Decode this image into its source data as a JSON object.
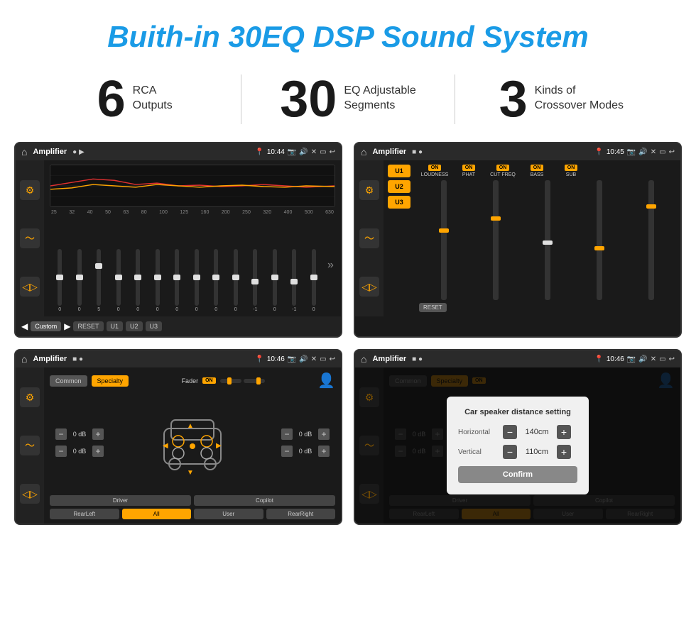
{
  "header": {
    "title": "Buith-in 30EQ DSP Sound System"
  },
  "stats": [
    {
      "number": "6",
      "label": "RCA\nOutputs"
    },
    {
      "number": "30",
      "label": "EQ Adjustable\nSegments"
    },
    {
      "number": "3",
      "label": "Kinds of\nCrossover Modes"
    }
  ],
  "screens": {
    "screen1": {
      "topbar": {
        "app": "Amplifier",
        "time": "10:44"
      },
      "eq_freqs": [
        "25",
        "32",
        "40",
        "50",
        "63",
        "80",
        "100",
        "125",
        "160",
        "200",
        "250",
        "320",
        "400",
        "500",
        "630"
      ],
      "eq_values": [
        "0",
        "0",
        "0",
        "5",
        "0",
        "0",
        "0",
        "0",
        "0",
        "0",
        "0",
        "-1",
        "0",
        "-1"
      ],
      "bottom_buttons": [
        "Custom",
        "RESET",
        "U1",
        "U2",
        "U3"
      ]
    },
    "screen2": {
      "topbar": {
        "app": "Amplifier",
        "time": "10:45"
      },
      "u_buttons": [
        "U1",
        "U2",
        "U3"
      ],
      "channels": [
        "LOUDNESS",
        "PHAT",
        "CUT FREQ",
        "BASS",
        "SUB"
      ],
      "reset_label": "RESET"
    },
    "screen3": {
      "topbar": {
        "app": "Amplifier",
        "time": "10:46"
      },
      "tabs": [
        "Common",
        "Specialty"
      ],
      "fader_label": "Fader",
      "db_rows": [
        "0 dB",
        "0 dB",
        "0 dB",
        "0 dB"
      ],
      "bottom_buttons": [
        "Driver",
        "Copilot",
        "RearLeft",
        "All",
        "User",
        "RearRight"
      ]
    },
    "screen4": {
      "topbar": {
        "app": "Amplifier",
        "time": "10:46"
      },
      "tabs": [
        "Common",
        "Specialty"
      ],
      "dialog": {
        "title": "Car speaker distance setting",
        "rows": [
          {
            "label": "Horizontal",
            "value": "140cm"
          },
          {
            "label": "Vertical",
            "value": "110cm"
          }
        ],
        "confirm_label": "Confirm"
      },
      "db_rows": [
        "0 dB",
        "0 dB"
      ],
      "bottom_buttons": [
        "Driver",
        "Copilot",
        "RearLeft",
        "All",
        "User",
        "RearRight"
      ]
    }
  }
}
